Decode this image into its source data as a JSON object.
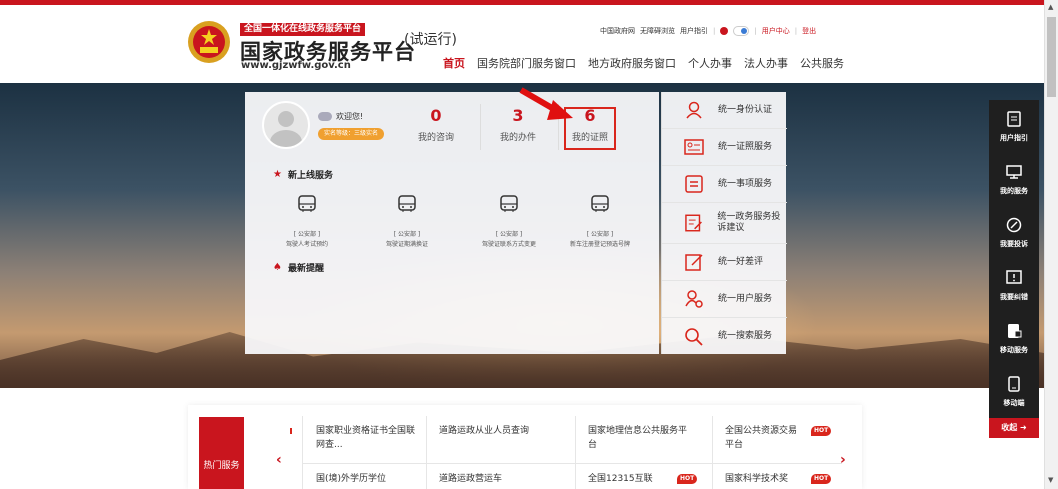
{
  "header": {
    "logo_tag": "全国一体化在线政务服务平台",
    "logo_title": "国家政务服务平台",
    "logo_url": "www.gjzwfw.gov.cn",
    "trial": "(试运行)",
    "util_links": [
      "中国政府网",
      "无障碍浏览",
      "用户指引"
    ],
    "user_center": "用户中心",
    "logout": "登出",
    "nav": [
      "首页",
      "国务院部门服务窗口",
      "地方政府服务窗口",
      "个人办事",
      "法人办事",
      "公共服务"
    ]
  },
  "user": {
    "welcome": "欢迎您!",
    "rank": "实名等级：三级实名"
  },
  "stats": [
    {
      "num": "0",
      "label": "我的咨询"
    },
    {
      "num": "3",
      "label": "我的办件"
    },
    {
      "num": "6",
      "label": "我的证照"
    }
  ],
  "new_services": {
    "title": "新上线服务",
    "items": [
      {
        "dept": "[ 公安部 ]",
        "name": "驾驶人考试预约"
      },
      {
        "dept": "[ 公安部 ]",
        "name": "驾驶证期满换证"
      },
      {
        "dept": "[ 公安部 ]",
        "name": "驾驶证联系方式变更"
      },
      {
        "dept": "[ 公安部 ]",
        "name": "新车注册登记预选号牌"
      }
    ]
  },
  "reminders": {
    "title": "最新提醒"
  },
  "right_list": [
    {
      "icon": "person-icon",
      "label": "统一身份认证"
    },
    {
      "icon": "id-card-icon",
      "label": "统一证照服务"
    },
    {
      "icon": "list-icon",
      "label": "统一事项服务"
    },
    {
      "icon": "complaint-icon",
      "label": "统一政务服务投诉建议"
    },
    {
      "icon": "pen-icon",
      "label": "统一好差评"
    },
    {
      "icon": "user-service-icon",
      "label": "统一用户服务"
    },
    {
      "icon": "search-icon",
      "label": "统一搜索服务"
    }
  ],
  "sidebar": {
    "items": [
      "用户指引",
      "我的服务",
      "我要投诉",
      "我要纠错",
      "移动服务",
      "移动端"
    ],
    "collapse": "收起"
  },
  "hot": {
    "tab": "热门服务",
    "row1": [
      {
        "text": "国家职业资格证书全国联网查...",
        "hot": false
      },
      {
        "text": "道路运政从业人员查询",
        "hot": false
      },
      {
        "text": "国家地理信息公共服务平台",
        "hot": false
      },
      {
        "text": "全国公共资源交易平台",
        "hot": true
      }
    ],
    "row2": [
      {
        "text": "国(境)外学历学位",
        "hot": false
      },
      {
        "text": "道路运政营运车",
        "hot": false
      },
      {
        "text": "全国12315互联",
        "hot": true
      },
      {
        "text": "国家科学技术奖",
        "hot": true
      }
    ],
    "badge": "HOT"
  },
  "colors": {
    "brand_red": "#c9151e",
    "highlight": "#d9261c",
    "sidebar_bg": "#1f1f1f"
  }
}
